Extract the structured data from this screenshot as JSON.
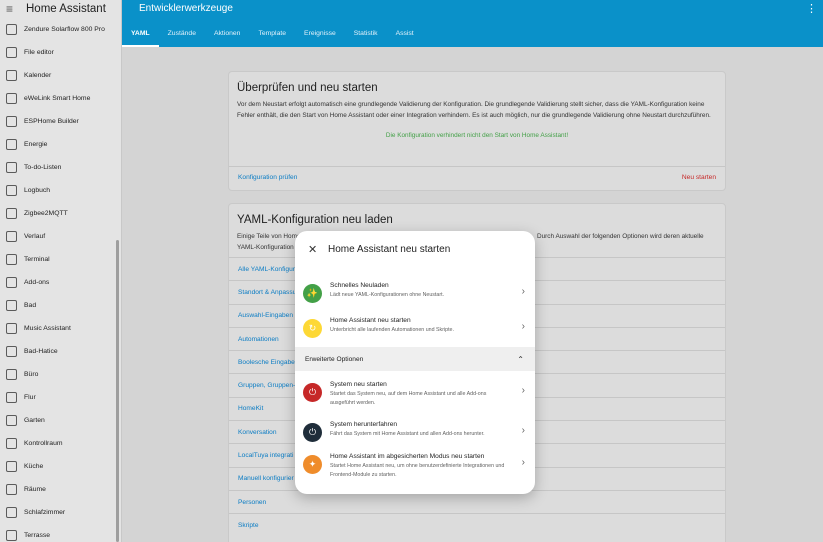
{
  "sidebar": {
    "title": "Home Assistant",
    "items": [
      {
        "label": "Zendure Solarflow 800 Pro",
        "icon": "solar-panel-icon"
      },
      {
        "label": "File editor",
        "icon": "wrench-icon"
      },
      {
        "label": "Kalender",
        "icon": "calendar-icon"
      },
      {
        "label": "eWeLink Smart Home",
        "icon": "globe-icon"
      },
      {
        "label": "ESPHome Builder",
        "icon": "esphome-icon"
      },
      {
        "label": "Energie",
        "icon": "lightning-icon"
      },
      {
        "label": "To-do-Listen",
        "icon": "clipboard-icon"
      },
      {
        "label": "Logbuch",
        "icon": "list-icon"
      },
      {
        "label": "Zigbee2MQTT",
        "icon": "zigbee-icon"
      },
      {
        "label": "Verlauf",
        "icon": "chart-icon"
      },
      {
        "label": "Terminal",
        "icon": "terminal-icon"
      },
      {
        "label": "Add-ons",
        "icon": "puzzle-icon"
      },
      {
        "label": "Bad",
        "icon": "dashboard-icon"
      },
      {
        "label": "Music Assistant",
        "icon": "music-icon"
      },
      {
        "label": "Bad-Hatice",
        "icon": "dashboard-icon"
      },
      {
        "label": "Büro",
        "icon": "dashboard-icon"
      },
      {
        "label": "Flur",
        "icon": "dashboard-icon"
      },
      {
        "label": "Garten",
        "icon": "dashboard-icon"
      },
      {
        "label": "Kontrollraum",
        "icon": "dashboard-icon"
      },
      {
        "label": "Küche",
        "icon": "dashboard-icon"
      },
      {
        "label": "Räume",
        "icon": "dashboard-icon"
      },
      {
        "label": "Schlafzimmer",
        "icon": "dashboard-icon"
      },
      {
        "label": "Terrasse",
        "icon": "dashboard-icon"
      }
    ]
  },
  "header": {
    "title": "Entwicklerwerkzeuge",
    "tabs": [
      "YAML",
      "Zustände",
      "Aktionen",
      "Template",
      "Ereignisse",
      "Statistik",
      "Assist"
    ],
    "active_tab": "YAML"
  },
  "card_check": {
    "title": "Überprüfen und neu starten",
    "description": "Vor dem Neustart erfolgt automatisch eine grundlegende Validierung der Konfiguration. Die grundlegende Validierung stellt sicher, dass die YAML-Konfiguration keine Fehler enthält, die den Start von Home Assistant oder einer Integration verhindern. Es ist auch möglich, nur die grundlegende Validierung ohne Neustart durchzuführen.",
    "status": "Die Konfiguration verhindert nicht den Start von Home Assistant!",
    "check_label": "Konfiguration prüfen",
    "restart_label": "Neu starten"
  },
  "card_reload": {
    "title": "YAML-Konfiguration neu laden",
    "description_start": "Einige Teile von Home",
    "description_end": "Durch Auswahl der folgenden Optionen wird deren aktuelle",
    "description_line2": "YAML-Konfiguration",
    "items": [
      "Alle YAML-Konfigur",
      "Standort & Anpassu",
      "Auswahl-Eingaben",
      "Automationen",
      "Boolesche Eingabe",
      "Gruppen, Gruppen-",
      "HomeKit",
      "Konversation",
      "LocalTuya integrati",
      "Manuell konfigurier",
      "Personen",
      "Skripte"
    ]
  },
  "dialog": {
    "title": "Home Assistant neu starten",
    "close_icon": "close-icon",
    "options": [
      {
        "title": "Schnelles Neuladen",
        "subtitle": "Lädt neue YAML-Konfigurationen ohne Neustart.",
        "color": "#43a047",
        "icon": "auto-fix-icon"
      },
      {
        "title": "Home Assistant neu starten",
        "subtitle": "Unterbricht alle laufenden Automationen und Skripte.",
        "color": "#fdd835",
        "icon": "refresh-icon"
      }
    ],
    "advanced_label": "Erweiterte Optionen",
    "advanced": [
      {
        "title": "System neu starten",
        "subtitle": "Startet das System neu, auf dem Home Assistant und alle Add-ons ausgeführt werden.",
        "color": "#c62828",
        "icon": "power-cycle-icon"
      },
      {
        "title": "System herunterfahren",
        "subtitle": "Fährt das System mit Home Assistant und allen Add-ons herunter.",
        "color": "#1f2d3a",
        "icon": "power-icon"
      },
      {
        "title": "Home Assistant im abgesicherten Modus neu starten",
        "subtitle": "Startet Home Assistant neu, um ohne benutzerdefinierte Integrationen und Frontend-Module zu starten.",
        "color": "#ef8c2b",
        "icon": "safe-mode-icon"
      }
    ]
  }
}
